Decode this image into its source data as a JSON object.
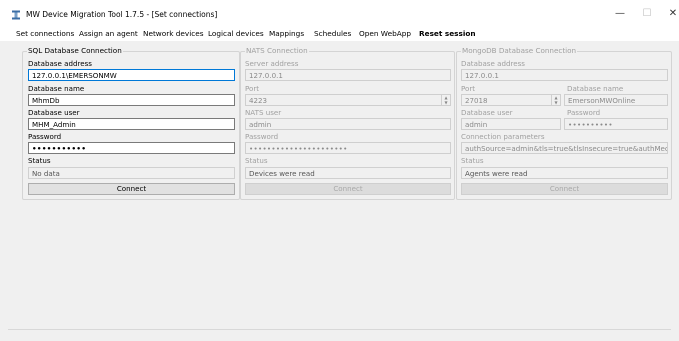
{
  "window": {
    "title": "MW Device Migration Tool 1.7.5 - [Set connections]",
    "minimize_glyph": "—",
    "maximize_glyph": "☐",
    "close_glyph": "✕"
  },
  "menu": [
    "Set connections",
    "Assign an agent",
    "Network devices",
    "Logical devices",
    "Mappings",
    "Schedules",
    "Open WebApp",
    "Reset session"
  ],
  "sql": {
    "group_title": "SQL Database Connection",
    "address_label": "Database address",
    "address_value": "127.0.0.1\\EMERSONMW",
    "name_label": "Database name",
    "name_value": "MhmDb",
    "user_label": "Database user",
    "user_value": "MHM_Admin",
    "password_label": "Password",
    "password_value": "•••••••••••",
    "status_label": "Status",
    "status_value": "No data",
    "connect_label": "Connect"
  },
  "nats": {
    "group_title": "NATS Connection",
    "server_label": "Server address",
    "server_value": "127.0.0.1",
    "port_label": "Port",
    "port_value": "4223",
    "user_label": "NATS user",
    "user_value": "admin",
    "password_label": "Password",
    "password_value": "••••••••••••••••••••••",
    "status_label": "Status",
    "status_value": "Devices were read",
    "connect_label": "Connect"
  },
  "mongo": {
    "group_title": "MongoDB Database Connection",
    "address_label": "Database address",
    "address_value": "127.0.0.1",
    "port_label": "Port",
    "port_value": "27018",
    "dbname_label": "Database name",
    "dbname_value": "EmersonMWOnline",
    "user_label": "Database user",
    "user_value": "admin",
    "password_label": "Password",
    "password_value": "••••••••••",
    "params_label": "Connection parameters",
    "params_value": "authSource=admin&tls=true&tlsInsecure=true&authMechani",
    "status_label": "Status",
    "status_value": "Agents were read",
    "connect_label": "Connect"
  }
}
